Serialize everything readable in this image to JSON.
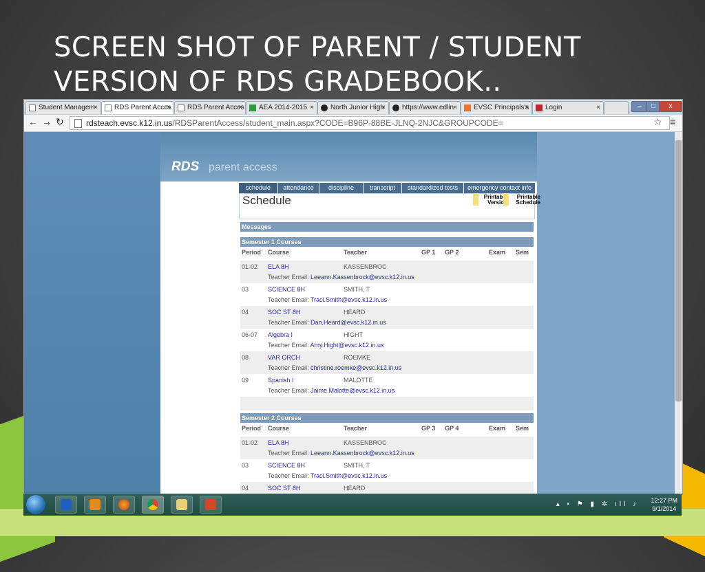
{
  "slide": {
    "title_line1": "SCREEN SHOT OF PARENT / STUDENT",
    "title_line2": "VERSION OF RDS GRADEBOOK.."
  },
  "browser": {
    "tabs": [
      {
        "label": "Student Managem",
        "active": false
      },
      {
        "label": "RDS Parent Acces",
        "active": true
      },
      {
        "label": "RDS Parent Acces",
        "active": false
      },
      {
        "label": "AEA 2014-2015",
        "active": false
      },
      {
        "label": "North Junior High",
        "active": false
      },
      {
        "label": "https://www.edlin",
        "active": false
      },
      {
        "label": "EVSC Principals's I",
        "active": false
      },
      {
        "label": "Login",
        "active": false
      }
    ],
    "url_host": "rdsteach.evsc.k12.in.us",
    "url_path": "/RDSParentAccess/student_main.aspx?CODE=B96P-88BE-JLNQ-2NJC&GROUPCODE="
  },
  "rds": {
    "logo": "RDS",
    "subtitle": "parent access",
    "tabs": [
      "schedule",
      "attendance",
      "discipline",
      "transcript",
      "standardized tests",
      "emergency contact info"
    ],
    "page_title": "Schedule",
    "printable_version": "Printable Version",
    "printable_schedule": "Printable Schedule",
    "messages_label": "Messages",
    "email_label": "Teacher Email:",
    "semester1": {
      "title": "Semester 1 Courses",
      "columns": [
        "Period",
        "Course",
        "Teacher",
        "GP 1",
        "GP 2",
        "Exam",
        "Sem"
      ],
      "rows": [
        {
          "period": "01-02",
          "course": "ELA 8H",
          "teacher": "KASSENBROC",
          "email": "Leeann.Kassenbrock@evsc.k12.in.us"
        },
        {
          "period": "03",
          "course": "SCIENCE 8H",
          "teacher": "SMITH, T",
          "email": "Traci.Smith@evsc.k12.in.us"
        },
        {
          "period": "04",
          "course": "SOC ST 8H",
          "teacher": "HEARD",
          "email": "Dan.Heard@evsc.k12.in.us"
        },
        {
          "period": "06-07",
          "course": "Algebra I",
          "teacher": "HIGHT",
          "email": "Amy.Hight@evsc.k12.in.us"
        },
        {
          "period": "08",
          "course": "VAR ORCH",
          "teacher": "ROEMKE",
          "email": "christine.roemke@evsc.k12.in.us"
        },
        {
          "period": "09",
          "course": "Spanish I",
          "teacher": "MALOTTE",
          "email": "Jaime.Malotte@evsc.k12.in.us"
        }
      ]
    },
    "semester2": {
      "title": "Semester 2 Courses",
      "columns": [
        "Period",
        "Course",
        "Teacher",
        "GP 3",
        "GP 4",
        "Exam",
        "Sem"
      ],
      "rows": [
        {
          "period": "01-02",
          "course": "ELA 8H",
          "teacher": "KASSENBROC",
          "email": "Leeann.Kassenbrock@evsc.k12.in.us"
        },
        {
          "period": "03",
          "course": "SCIENCE 8H",
          "teacher": "SMITH, T",
          "email": "Traci.Smith@evsc.k12.in.us"
        },
        {
          "period": "04",
          "course": "SOC ST 8H",
          "teacher": "HEARD",
          "email": ""
        }
      ]
    }
  },
  "taskbar": {
    "time": "12:27 PM",
    "date": "9/1/2014",
    "apps": [
      "windows-media-player-icon",
      "outlook-icon",
      "firefox-icon",
      "chrome-icon",
      "file-explorer-icon",
      "powerpoint-icon"
    ]
  },
  "colors": {
    "page_blue": "#4d7fa8",
    "tab_blue": "#4a6c8c",
    "section_bar": "#7d9cbc",
    "link": "#2a2aa8"
  }
}
